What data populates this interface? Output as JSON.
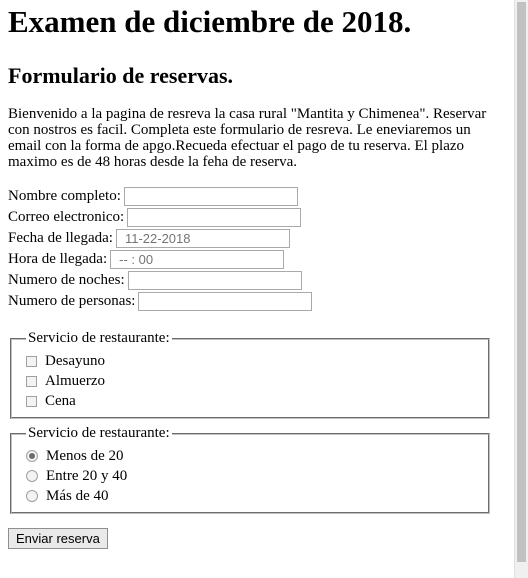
{
  "header": {
    "title": "Examen de diciembre de 2018.",
    "subtitle": "Formulario de reservas."
  },
  "intro_text": "Bienvenido a la pagina de resreva la casa rural \"Mantita y Chimenea\". Reservar con nostros es facil. Completa este formulario de resreva. Le eneviaremos un email con la forma de apgo.Recueda efectuar el pago de tu reserva. El plazo maximo es de 48 horas desde la feha de reserva.",
  "form": {
    "fields": [
      {
        "label": "Nombre completo:",
        "value": ""
      },
      {
        "label": "Correo electronico:",
        "value": ""
      },
      {
        "label": "Fecha de llegada:",
        "value": "11-22-2018"
      },
      {
        "label": "Hora de llegada:",
        "value": "-- : 00"
      },
      {
        "label": "Numero de noches:",
        "value": ""
      },
      {
        "label": "Numero de personas:",
        "value": ""
      }
    ],
    "fieldset1": {
      "legend": "Servicio de restaurante:",
      "options": [
        {
          "label": "Desayuno",
          "checked": false
        },
        {
          "label": "Almuerzo",
          "checked": false
        },
        {
          "label": "Cena",
          "checked": false
        }
      ]
    },
    "fieldset2": {
      "legend": "Servicio de restaurante:",
      "options": [
        {
          "label": "Menos de 20",
          "checked": true
        },
        {
          "label": "Entre 20 y 40",
          "checked": false
        },
        {
          "label": "Más de 40",
          "checked": false
        }
      ]
    },
    "submit_label": "Enviar reserva"
  }
}
